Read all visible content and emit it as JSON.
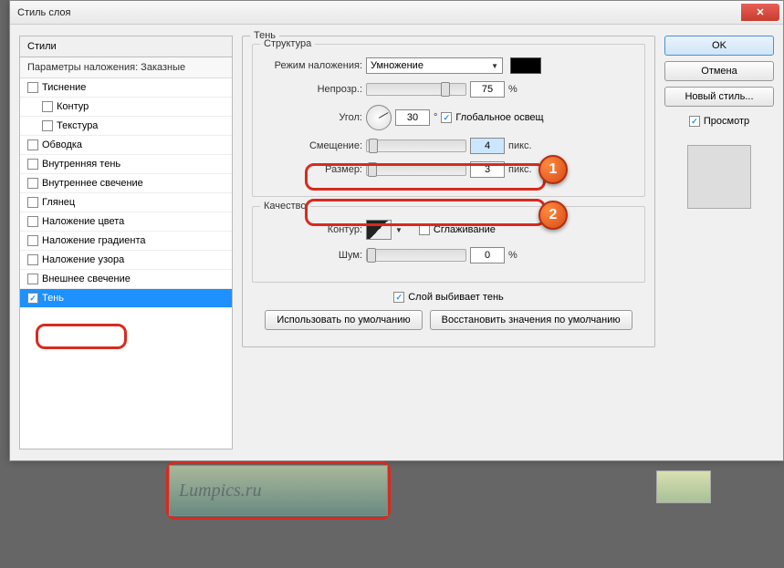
{
  "window": {
    "title": "Стиль слоя"
  },
  "left": {
    "header": "Стили",
    "sub": "Параметры наложения: Заказные",
    "items": [
      {
        "label": "Тиснение",
        "checked": false,
        "indent": false
      },
      {
        "label": "Контур",
        "checked": false,
        "indent": true
      },
      {
        "label": "Текстура",
        "checked": false,
        "indent": true
      },
      {
        "label": "Обводка",
        "checked": false,
        "indent": false
      },
      {
        "label": "Внутренняя тень",
        "checked": false,
        "indent": false
      },
      {
        "label": "Внутреннее свечение",
        "checked": false,
        "indent": false
      },
      {
        "label": "Глянец",
        "checked": false,
        "indent": false
      },
      {
        "label": "Наложение цвета",
        "checked": false,
        "indent": false
      },
      {
        "label": "Наложение градиента",
        "checked": false,
        "indent": false
      },
      {
        "label": "Наложение узора",
        "checked": false,
        "indent": false
      },
      {
        "label": "Внешнее свечение",
        "checked": false,
        "indent": false
      },
      {
        "label": "Тень",
        "checked": true,
        "indent": false,
        "selected": true
      }
    ]
  },
  "main": {
    "group": "Тень",
    "structure": {
      "legend": "Структура",
      "blend_label": "Режим наложения:",
      "blend_value": "Умножение",
      "opacity_label": "Непрозр.:",
      "opacity_value": "75",
      "opacity_unit": "%",
      "angle_label": "Угол:",
      "angle_value": "30",
      "angle_unit": "°",
      "global_label": "Глобальное освещ",
      "distance_label": "Смещение:",
      "distance_value": "4",
      "distance_unit": "пикс.",
      "size_label": "Размер:",
      "size_value": "3",
      "size_unit": "пикс."
    },
    "quality": {
      "legend": "Качество",
      "contour_label": "Контур:",
      "aa_label": "Сглаживание",
      "noise_label": "Шум:",
      "noise_value": "0",
      "noise_unit": "%"
    },
    "knockout_label": "Слой выбивает тень",
    "default_btn": "Использовать по умолчанию",
    "reset_btn": "Восстановить значения по умолчанию"
  },
  "right": {
    "ok": "OK",
    "cancel": "Отмена",
    "new_style": "Новый стиль...",
    "preview": "Просмотр"
  },
  "badges": {
    "one": "1",
    "two": "2"
  },
  "watermark": "Lumpics.ru"
}
